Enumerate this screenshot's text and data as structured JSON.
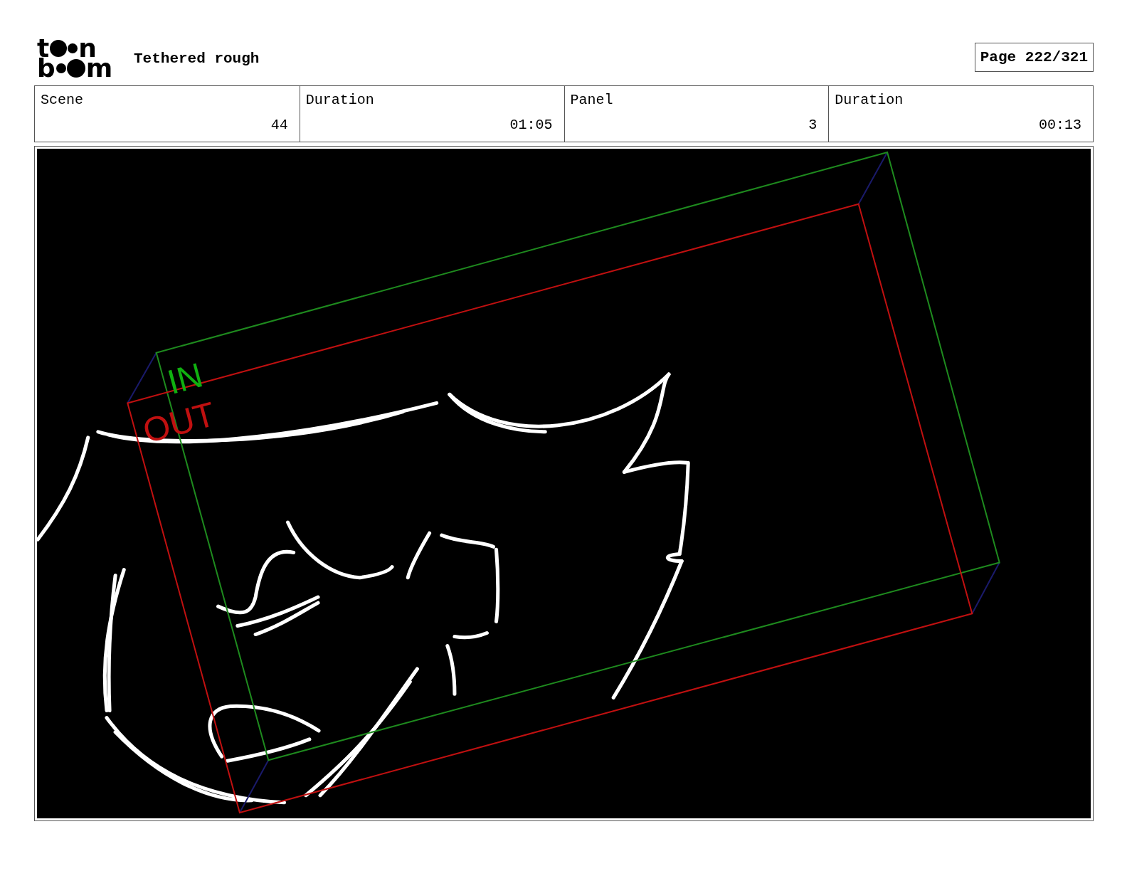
{
  "logo": {
    "line_1": [
      "t",
      "n"
    ],
    "line_2": [
      "b",
      "m"
    ]
  },
  "title": "Tethered rough",
  "page": "Page 222/321",
  "fields": [
    {
      "label": "Scene",
      "value": "44"
    },
    {
      "label": "Duration",
      "value": "01:05"
    },
    {
      "label": "Panel",
      "value": "3"
    },
    {
      "label": "Duration",
      "value": "00:13"
    }
  ],
  "panel": {
    "in_label": "IN",
    "out_label": "OUT"
  }
}
